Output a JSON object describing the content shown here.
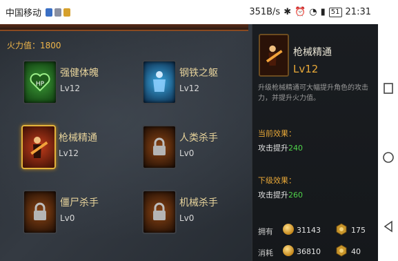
{
  "status_bar": {
    "carrier": "中国移动",
    "speed": "351B/s",
    "battery": "51",
    "time": "21:31"
  },
  "game": {
    "firepower_label": "火力值：1800",
    "skills": [
      {
        "name": "强健体魄",
        "level": "Lv12",
        "icon": "hp-heart-icon",
        "locked": false,
        "selected": false
      },
      {
        "name": "钢铁之躯",
        "level": "Lv12",
        "icon": "steel-body-icon",
        "locked": false,
        "selected": false
      },
      {
        "name": "枪械精通",
        "level": "Lv12",
        "icon": "gun-mastery-icon",
        "locked": false,
        "selected": true
      },
      {
        "name": "人类杀手",
        "level": "Lv0",
        "icon": "lock-icon",
        "locked": true,
        "selected": false
      },
      {
        "name": "僵尸杀手",
        "level": "Lv0",
        "icon": "lock-icon",
        "locked": true,
        "selected": false
      },
      {
        "name": "机械杀手",
        "level": "Lv0",
        "icon": "lock-icon",
        "locked": true,
        "selected": false
      }
    ]
  },
  "panel": {
    "title": "枪械精通",
    "level": "Lv12",
    "description": "升级枪械精通可大幅提升角色的攻击力，并提升火力值。",
    "current_header": "当前效果：",
    "current_prefix": "攻击提升",
    "current_value": "240",
    "next_header": "下级效果：",
    "next_prefix": "攻击提升",
    "next_value": "260",
    "owned_label": "拥有",
    "owned_gold": "31143",
    "owned_badge": "175",
    "cost_label": "消耗",
    "cost_gold": "36810",
    "cost_badge": "40"
  },
  "colors": {
    "accent_gold": "#e8a838",
    "value_green": "#4fd34a"
  }
}
